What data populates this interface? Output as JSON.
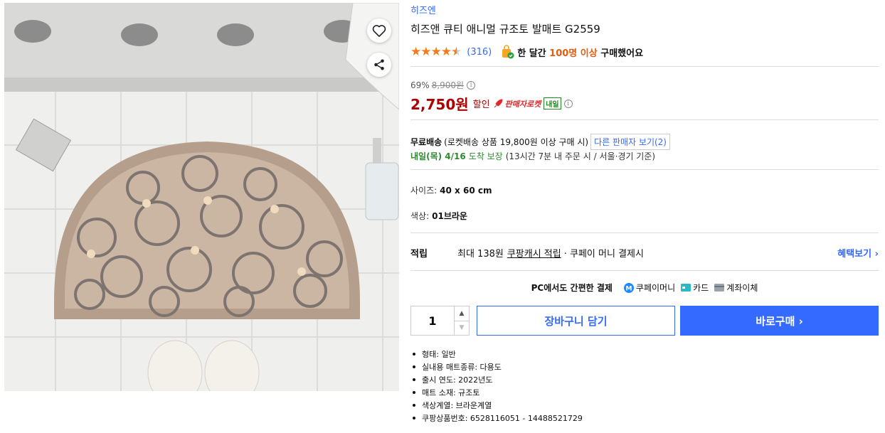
{
  "product": {
    "brand": "히즈엔",
    "title": "히즈앤 큐티 애니멀 규조토 발매트 G2559",
    "rating": 4.5,
    "review_count": "(316)",
    "purchase_prefix": "한 달간",
    "purchase_highlight": "100명 이상",
    "purchase_suffix": "구매했어요"
  },
  "price": {
    "discount_rate": "69%",
    "original": "8,900원",
    "sale": "2,750원",
    "discount_label": "할인",
    "rocket_label": "판매자로켓",
    "tomorrow_tag": "내일"
  },
  "shipping": {
    "free_label": "무료배송",
    "condition": "(로켓배송 상품 19,800원 이상 구매 시)",
    "other_sellers": "다른 판매자 보기(2)",
    "arrival_day": "내일(목) 4/16",
    "arrival_guarantee": "도착 보장",
    "arrival_note": "(13시간 7분 내 주문 시 / 서울·경기 기준)"
  },
  "options": {
    "size_label": "사이즈:",
    "size_value": "40 x 60 cm",
    "color_label": "색상:",
    "color_value": "01브라운"
  },
  "reward": {
    "label": "적립",
    "prefix": "최대 138원",
    "cash": "쿠팡캐시 적립",
    "suffix": "· 쿠페이 머니 결제시",
    "benefit_link": "혜택보기 ›"
  },
  "payment": {
    "title": "PC에서도 간편한 결제",
    "methods": [
      "쿠페이머니",
      "카드",
      "계좌이체"
    ]
  },
  "purchase": {
    "quantity": "1",
    "cart_label": "장바구니 담기",
    "buy_label": "바로구매 ›"
  },
  "specs": [
    "형태: 일반",
    "실내용 매트종류: 다용도",
    "출시 연도: 2022년도",
    "매트 소재: 규조토",
    "색상계열: 브라운계열",
    "쿠팡상품번호: 6528116051 - 14488521729"
  ],
  "colors": {
    "accent": "#346aff",
    "price": "#ae0000",
    "star": "#f57c1b",
    "delivery": "#2e8a2e"
  },
  "icons": {
    "like": "heart-icon",
    "share": "share-icon",
    "info": "info-icon",
    "rocket": "rocket-icon",
    "coupay": "coupay-icon",
    "card": "card-icon",
    "bank": "bank-icon"
  }
}
